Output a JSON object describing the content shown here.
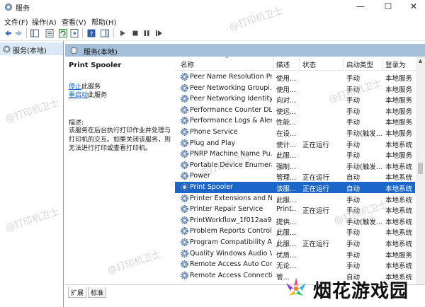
{
  "window": {
    "title": "服务"
  },
  "menu": [
    "文件(F)",
    "操作(A)",
    "查看(V)",
    "帮助(H)"
  ],
  "tree": {
    "root_label": "服务(本地)"
  },
  "pane": {
    "header_label": "服务(本地)"
  },
  "detail": {
    "service_name": "Print Spooler",
    "stop_link": "停止",
    "stop_suffix": "此服务",
    "restart_link": "重启动",
    "restart_suffix": "此服务",
    "desc_label": "描述:",
    "desc_text": "该服务在后台执行打印作业并处理与打印机的交互。如果关闭该服务，则无法进行打印或查看打印机。"
  },
  "columns": [
    "名称",
    "描述",
    "状态",
    "启动类型",
    "登录为"
  ],
  "rows": [
    {
      "name": "Peer Name Resolution Pr...",
      "desc": "使用...",
      "status": "",
      "start": "手动",
      "logon": "本地服务"
    },
    {
      "name": "Peer Networking Groupi...",
      "desc": "使用...",
      "status": "",
      "start": "手动",
      "logon": "本地服务"
    },
    {
      "name": "Peer Networking Identity...",
      "desc": "向对...",
      "status": "",
      "start": "手动",
      "logon": "本地服务"
    },
    {
      "name": "Performance Counter DL...",
      "desc": "使远...",
      "status": "",
      "start": "手动",
      "logon": "本地服务"
    },
    {
      "name": "Performance Logs & Aler...",
      "desc": "性能...",
      "status": "",
      "start": "手动",
      "logon": "本地服务"
    },
    {
      "name": "Phone Service",
      "desc": "在设...",
      "status": "",
      "start": "手动(触发...",
      "logon": "本地服务"
    },
    {
      "name": "Plug and Play",
      "desc": "使计...",
      "status": "正在运行",
      "start": "手动",
      "logon": "本地系统"
    },
    {
      "name": "PNRP Machine Name Pu...",
      "desc": "此服...",
      "status": "",
      "start": "手动",
      "logon": "本地服务"
    },
    {
      "name": "Portable Device Enumera...",
      "desc": "强制...",
      "status": "",
      "start": "手动(触发...",
      "logon": "本地系统"
    },
    {
      "name": "Power",
      "desc": "管理...",
      "status": "正在运行",
      "start": "自动",
      "logon": "本地系统"
    },
    {
      "name": "Print Spooler",
      "desc": "该服...",
      "status": "正在运行",
      "start": "自动",
      "logon": "本地系统",
      "selected": true
    },
    {
      "name": "Printer Extensions and N...",
      "desc": "此服...",
      "status": "",
      "start": "手动",
      "logon": "本地系统"
    },
    {
      "name": "Printer Repair Service",
      "desc": "Print...",
      "status": "正在运行",
      "start": "手动",
      "logon": "本地系统"
    },
    {
      "name": "PrintWorkflow_1f012aa9",
      "desc": "提供...",
      "status": "",
      "start": "手动(触发...",
      "logon": "本地系统"
    },
    {
      "name": "Problem Reports Control...",
      "desc": "此服...",
      "status": "",
      "start": "手动",
      "logon": "本地系统"
    },
    {
      "name": "Program Compatibility A...",
      "desc": "此服...",
      "status": "正在运行",
      "start": "手动",
      "logon": "本地系统"
    },
    {
      "name": "Quality Windows Audio V...",
      "desc": "优质...",
      "status": "",
      "start": "手动",
      "logon": "本地服务"
    },
    {
      "name": "Remote Access Auto Con...",
      "desc": "无论...",
      "status": "",
      "start": "手动",
      "logon": "本地系统"
    },
    {
      "name": "Remote Access Connecti...",
      "desc": "管...",
      "status": "",
      "start": "自动",
      "logon": "本地系统"
    }
  ],
  "tabs": [
    "扩展",
    "标准"
  ],
  "watermark": "@打印机卫士",
  "brand": {
    "text": "烟花游戏园"
  },
  "colors": {
    "selection": "#1b66c8",
    "header": "#a6bfd9",
    "link": "#0b62c4"
  }
}
